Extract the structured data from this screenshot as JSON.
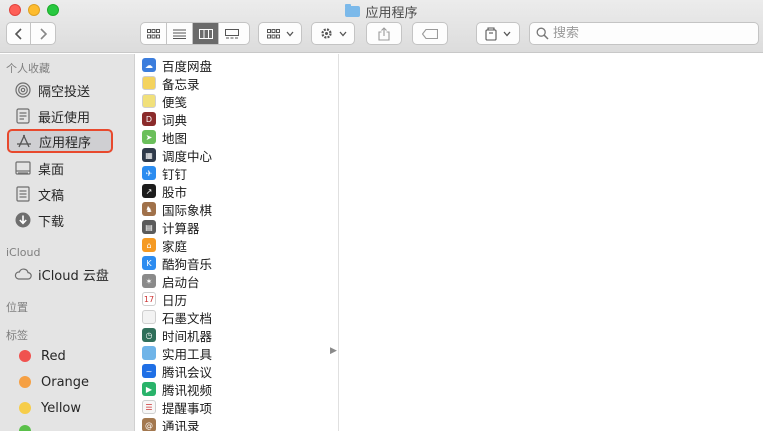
{
  "window": {
    "title": "应用程序"
  },
  "toolbar": {
    "back_label": "‹",
    "forward_label": "›",
    "view_modes": [
      "icons",
      "list",
      "columns",
      "gallery"
    ],
    "active_view": "columns",
    "group_icon": "grid-icon",
    "action_icon": "gear-icon",
    "share_icon": "share-icon",
    "tag_icon": "tag-icon",
    "drive_icon": "drive-icon",
    "search_placeholder": "搜索"
  },
  "sidebar": {
    "favorites_title": "个人收藏",
    "favorites": [
      {
        "label": "隔空投送",
        "icon": "airdrop-icon"
      },
      {
        "label": "最近使用",
        "icon": "recents-icon"
      },
      {
        "label": "应用程序",
        "icon": "applications-icon"
      },
      {
        "label": "桌面",
        "icon": "desktop-icon"
      },
      {
        "label": "文稿",
        "icon": "documents-icon"
      },
      {
        "label": "下载",
        "icon": "downloads-icon"
      }
    ],
    "selected_favorite": "应用程序",
    "icloud_title": "iCloud",
    "icloud_items": [
      {
        "label": "iCloud 云盘",
        "icon": "cloud-icon"
      }
    ],
    "locations_title": "位置",
    "tags_title": "标签",
    "tags": [
      {
        "label": "Red",
        "color": "#f0524f"
      },
      {
        "label": "Orange",
        "color": "#f5a044"
      },
      {
        "label": "Yellow",
        "color": "#f6cd4a"
      }
    ],
    "partial_tag_color": "#5ac04a"
  },
  "files": [
    {
      "name": "百度网盘",
      "icon": "baidu-netdisk-icon",
      "color": "#3b7ddd"
    },
    {
      "name": "备忘录",
      "icon": "notes-icon",
      "color": "#f4d35e"
    },
    {
      "name": "便笺",
      "icon": "stickies-icon",
      "color": "#f1e07a"
    },
    {
      "name": "词典",
      "icon": "dictionary-icon",
      "color": "#8b2b2b"
    },
    {
      "name": "地图",
      "icon": "maps-icon",
      "color": "#6bbf5b"
    },
    {
      "name": "调度中心",
      "icon": "mission-control-icon",
      "color": "#2f3a4a"
    },
    {
      "name": "钉钉",
      "icon": "dingtalk-icon",
      "color": "#2b8cf0"
    },
    {
      "name": "股市",
      "icon": "stocks-icon",
      "color": "#1c1c1c"
    },
    {
      "name": "国际象棋",
      "icon": "chess-icon",
      "color": "#a0714a"
    },
    {
      "name": "计算器",
      "icon": "calculator-icon",
      "color": "#5b5b5b"
    },
    {
      "name": "家庭",
      "icon": "home-icon",
      "color": "#f59a23"
    },
    {
      "name": "酷狗音乐",
      "icon": "kugou-icon",
      "color": "#2d8cf0"
    },
    {
      "name": "启动台",
      "icon": "launchpad-icon",
      "color": "#8a8a8a"
    },
    {
      "name": "日历",
      "icon": "calendar-icon",
      "color": "#ffffff"
    },
    {
      "name": "石墨文档",
      "icon": "shimo-icon",
      "color": "#f3f3f3"
    },
    {
      "name": "时间机器",
      "icon": "time-machine-icon",
      "color": "#2f6f5a"
    },
    {
      "name": "实用工具",
      "icon": "utilities-folder-icon",
      "color": "#6fb4e8"
    },
    {
      "name": "腾讯会议",
      "icon": "tencent-meeting-icon",
      "color": "#1f6fe5"
    },
    {
      "name": "腾讯视频",
      "icon": "tencent-video-icon",
      "color": "#29b36a"
    },
    {
      "name": "提醒事项",
      "icon": "reminders-icon",
      "color": "#f7f7f7"
    },
    {
      "name": "通讯录",
      "icon": "contacts-icon",
      "color": "#a3784f"
    }
  ],
  "expandable_item": "实用工具"
}
